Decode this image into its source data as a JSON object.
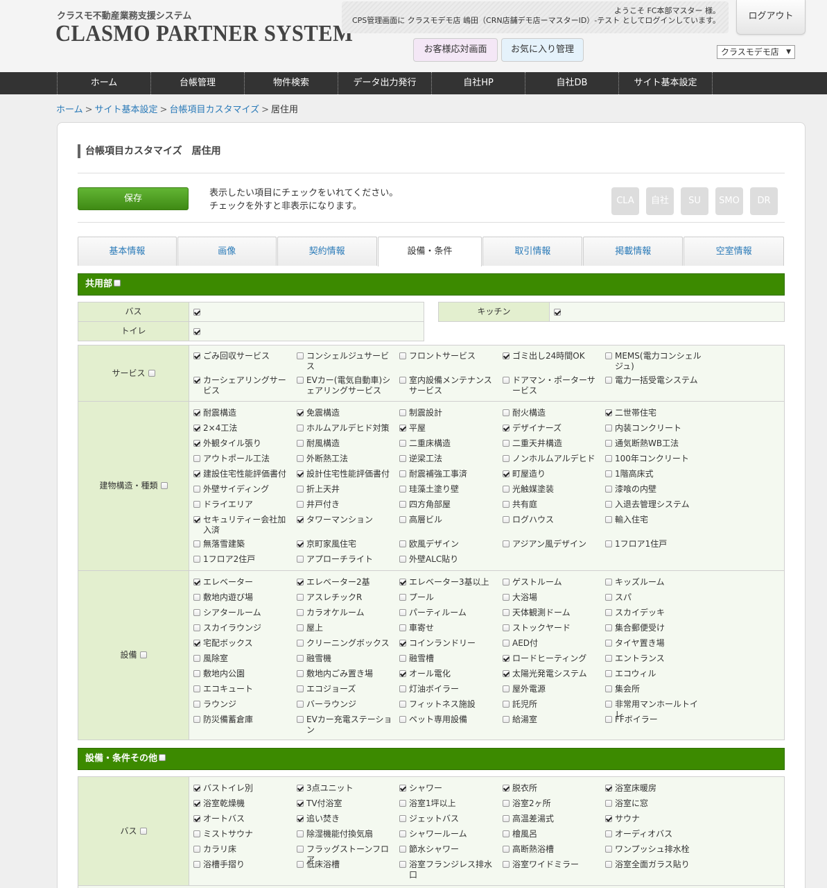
{
  "header": {
    "logo_sub": "クラスモ不動産業務支援システム",
    "logo_main": "CLASMO PARTNER SYSTEM",
    "welcome_line1": "ようこそ FC本部マスター 様。",
    "welcome_line2": "CPS管理画面に クラスモデモ店 嶋田（CRN店舗デモ店ーマスターID）-テスト としてログインしています。",
    "logout": "ログアウト",
    "customer_btn": "お客様応対画面",
    "favorite_btn": "お気に入り管理",
    "store_select": "クラスモデモ店",
    "colors": {
      "customer_btn_bg": "#f4e7f6",
      "favorite_btn_bg": "#e5f2fb",
      "nav_bg": "#333333",
      "accent_green": "#3c8a00"
    }
  },
  "nav": [
    "ホーム",
    "台帳管理",
    "物件検索",
    "データ出力発行",
    "自社HP",
    "自社DB",
    "サイト基本設定"
  ],
  "breadcrumb": {
    "items": [
      "ホーム",
      "サイト基本設定",
      "台帳項目カスタマイズ"
    ],
    "current": "居住用",
    "sep": ">"
  },
  "page": {
    "title": "台帳項目カスタマイズ　居住用",
    "save": "保存",
    "instr1": "表示したい項目にチェックをいれてください。",
    "instr2": "チェックを外すと非表示になります。",
    "site_buttons": [
      "CLA",
      "自社",
      "SU",
      "SMO",
      "DR"
    ]
  },
  "tabs": [
    {
      "label": "基本情報",
      "active": false
    },
    {
      "label": "画像",
      "active": false
    },
    {
      "label": "契約情報",
      "active": false
    },
    {
      "label": "設備・条件",
      "active": true
    },
    {
      "label": "取引情報",
      "active": false
    },
    {
      "label": "掲載情報",
      "active": false
    },
    {
      "label": "空室情報",
      "active": false
    }
  ],
  "sec1": {
    "title": "共用部",
    "simple": [
      {
        "label": "バス",
        "checked": true
      },
      {
        "label": "トイレ",
        "checked": true
      },
      {
        "label": "キッチン",
        "checked": true
      }
    ],
    "groups": [
      {
        "label": "サービス",
        "items": [
          [
            "ごみ回収サービス",
            true
          ],
          [
            "コンシェルジュサービス",
            false
          ],
          [
            "フロントサービス",
            false
          ],
          [
            "ゴミ出し24時間OK",
            true
          ],
          [
            "MEMS(電力コンシェルジュ)",
            false
          ],
          [
            "カーシェアリングサービス",
            true
          ],
          [
            "EVカー(電気自動車)シェアリングサービス",
            false
          ],
          [
            "室内設備メンテナンスサービス",
            false
          ],
          [
            "ドアマン・ポーターサービス",
            false
          ],
          [
            "電力一括受電システム",
            false
          ]
        ]
      },
      {
        "label": "建物構造・種類",
        "items": [
          [
            "耐震構造",
            true
          ],
          [
            "免震構造",
            true
          ],
          [
            "制震設計",
            false
          ],
          [
            "耐火構造",
            false
          ],
          [
            "二世帯住宅",
            true
          ],
          [
            "2×4工法",
            true
          ],
          [
            "ホルムアルデヒド対策",
            false
          ],
          [
            "平屋",
            true
          ],
          [
            "デザイナーズ",
            true
          ],
          [
            "内装コンクリート",
            false
          ],
          [
            "外観タイル張り",
            true
          ],
          [
            "耐風構造",
            false
          ],
          [
            "二重床構造",
            false
          ],
          [
            "二重天井構造",
            false
          ],
          [
            "通気断熱WB工法",
            false
          ],
          [
            "アウトポール工法",
            false
          ],
          [
            "外断熱工法",
            false
          ],
          [
            "逆梁工法",
            false
          ],
          [
            "ノンホルムアルデヒド",
            false
          ],
          [
            "100年コンクリート",
            false
          ],
          [
            "建設住宅性能評価書付",
            true
          ],
          [
            "設計住宅性能評価書付",
            true
          ],
          [
            "耐震補強工事済",
            false
          ],
          [
            "町屋造り",
            true
          ],
          [
            "1階高床式",
            false
          ],
          [
            "外壁サイディング",
            false
          ],
          [
            "折上天井",
            false
          ],
          [
            "珪藻土塗り壁",
            false
          ],
          [
            "光触媒塗装",
            false
          ],
          [
            "漆喰の内壁",
            false
          ],
          [
            "ドライエリア",
            false
          ],
          [
            "井戸付き",
            false
          ],
          [
            "四方角部屋",
            false
          ],
          [
            "共有庭",
            false
          ],
          [
            "入退去管理システム",
            false
          ],
          [
            "セキュリティー会社加入済",
            true
          ],
          [
            "タワーマンション",
            true
          ],
          [
            "高層ビル",
            false
          ],
          [
            "ログハウス",
            false
          ],
          [
            "輸入住宅",
            false
          ],
          [
            "無落雪建築",
            false
          ],
          [
            "京町家風住宅",
            true
          ],
          [
            "欧風デザイン",
            false
          ],
          [
            "アジアン風デザイン",
            false
          ],
          [
            "1フロア1住戸",
            false
          ],
          [
            "1フロア2住戸",
            false
          ],
          [
            "アプローチライト",
            false
          ],
          [
            "外壁ALC貼り",
            false
          ]
        ]
      },
      {
        "label": "設備",
        "items": [
          [
            "エレベーター",
            true
          ],
          [
            "エレベーター2基",
            true
          ],
          [
            "エレベーター3基以上",
            true
          ],
          [
            "ゲストルーム",
            false
          ],
          [
            "キッズルーム",
            false
          ],
          [
            "敷地内遊び場",
            false
          ],
          [
            "アスレチックR",
            false
          ],
          [
            "プール",
            false
          ],
          [
            "大浴場",
            false
          ],
          [
            "スパ",
            false
          ],
          [
            "シアタールーム",
            false
          ],
          [
            "カラオケルーム",
            false
          ],
          [
            "パーティルーム",
            false
          ],
          [
            "天体観測ドーム",
            false
          ],
          [
            "スカイデッキ",
            false
          ],
          [
            "スカイラウンジ",
            false
          ],
          [
            "屋上",
            false
          ],
          [
            "車寄せ",
            false
          ],
          [
            "ストックヤード",
            false
          ],
          [
            "集合郵便受け",
            false
          ],
          [
            "宅配ボックス",
            true
          ],
          [
            "クリーニングボックス",
            false
          ],
          [
            "コインランドリー",
            true
          ],
          [
            "AED付",
            false
          ],
          [
            "タイヤ置き場",
            false
          ],
          [
            "風除室",
            false
          ],
          [
            "融雪機",
            false
          ],
          [
            "融雪槽",
            false
          ],
          [
            "ロードヒーティング",
            true
          ],
          [
            "エントランス",
            false
          ],
          [
            "敷地内公園",
            false
          ],
          [
            "敷地内ごみ置き場",
            false
          ],
          [
            "オール電化",
            true
          ],
          [
            "太陽光発電システム",
            true
          ],
          [
            "エコウィル",
            false
          ],
          [
            "エコキュート",
            false
          ],
          [
            "エコジョーズ",
            false
          ],
          [
            "灯油ボイラー",
            false
          ],
          [
            "屋外電源",
            false
          ],
          [
            "集会所",
            false
          ],
          [
            "ラウンジ",
            false
          ],
          [
            "バーラウンジ",
            false
          ],
          [
            "フィットネス施設",
            false
          ],
          [
            "託児所",
            false
          ],
          [
            "非常用マンホールトイレ",
            false
          ],
          [
            "防災備蓄倉庫",
            false
          ],
          [
            "EVカー充電ステーション",
            false
          ],
          [
            "ペット専用設備",
            false
          ],
          [
            "給湯室",
            false
          ],
          [
            "FFボイラー",
            false
          ]
        ]
      }
    ]
  },
  "sec2": {
    "title": "設備・条件その他",
    "groups": [
      {
        "label": "バス",
        "items": [
          [
            "バストイレ別",
            true
          ],
          [
            "3点ユニット",
            true
          ],
          [
            "シャワー",
            true
          ],
          [
            "脱衣所",
            true
          ],
          [
            "浴室床暖房",
            true
          ],
          [
            "浴室乾燥機",
            true
          ],
          [
            "TV付浴室",
            true
          ],
          [
            "浴室1坪以上",
            false
          ],
          [
            "浴室2ヶ所",
            false
          ],
          [
            "浴室に窓",
            false
          ],
          [
            "オートバス",
            true
          ],
          [
            "追い焚き",
            true
          ],
          [
            "ジェットバス",
            false
          ],
          [
            "高温差湯式",
            false
          ],
          [
            "サウナ",
            true
          ],
          [
            "ミストサウナ",
            false
          ],
          [
            "除湿機能付換気扇",
            false
          ],
          [
            "シャワールーム",
            false
          ],
          [
            "檜風呂",
            false
          ],
          [
            "オーディオバス",
            false
          ],
          [
            "カラリ床",
            false
          ],
          [
            "フラッグストーンフロア",
            false
          ],
          [
            "節水シャワー",
            false
          ],
          [
            "高断熱浴槽",
            false
          ],
          [
            "ワンプッシュ排水栓",
            false
          ],
          [
            "浴槽手摺り",
            false
          ],
          [
            "低床浴槽",
            false
          ],
          [
            "浴室フランジレス排水口",
            false
          ],
          [
            "浴室ワイドミラー",
            false
          ],
          [
            "浴室全面ガラス貼り",
            false
          ]
        ]
      }
    ]
  }
}
